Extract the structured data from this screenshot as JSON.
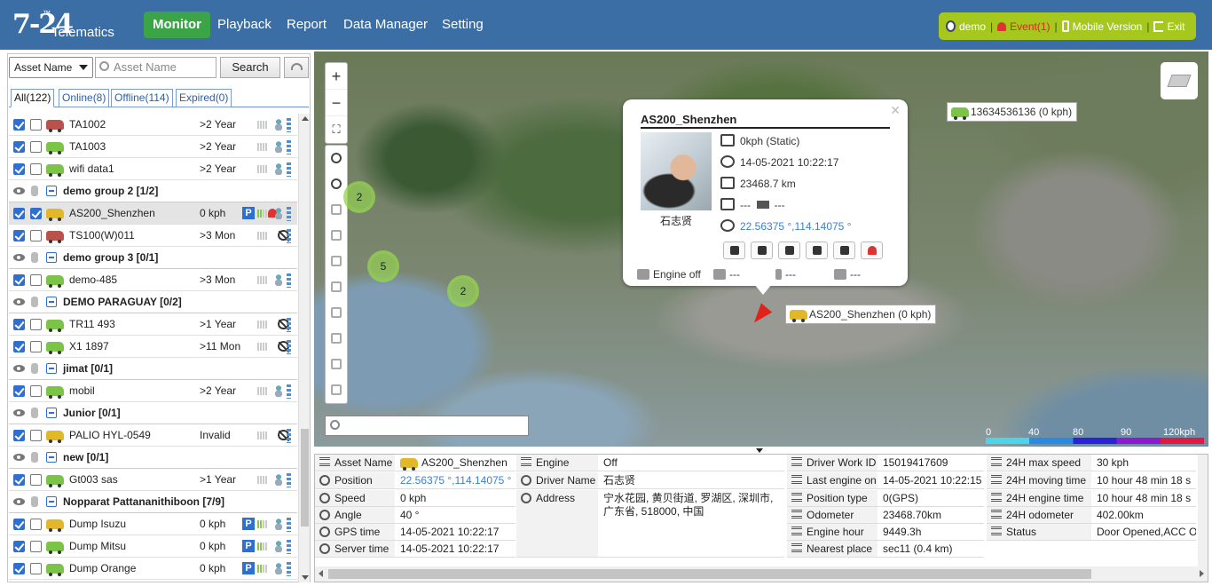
{
  "brand": {
    "logo_mark": "7-24",
    "logo_text": "Telematics",
    "tm": "™"
  },
  "nav": [
    "Monitor",
    "Playback",
    "Report",
    "Data Manager",
    "Setting"
  ],
  "user": {
    "name": "demo",
    "event": "Event(1)",
    "mobile": "Mobile Version",
    "exit": "Exit"
  },
  "filter": {
    "type_value": "Asset Name",
    "search_placeholder": "Asset Name",
    "search_button": "Search"
  },
  "tabs": [
    "All(122)",
    "Online(8)",
    "Offline(114)",
    "Expired(0)"
  ],
  "rows": [
    {
      "kind": "asset",
      "name": "TA1002",
      "time": ">2 Year",
      "car": "r",
      "cb2": false
    },
    {
      "kind": "asset",
      "name": "TA1003",
      "time": ">2 Year",
      "car": "g",
      "cb2": false
    },
    {
      "kind": "asset",
      "name": "wifi data1",
      "time": ">2 Year",
      "car": "g",
      "cb2": false
    },
    {
      "kind": "group",
      "name": "demo group 2 [1/2]"
    },
    {
      "kind": "asset",
      "name": "AS200_Shenzhen",
      "time": "0 kph",
      "car": "y",
      "cb2": true,
      "parked": true,
      "alarm": true,
      "selected": true
    },
    {
      "kind": "asset",
      "name": "TS100(W)011",
      "time": ">3 Mon",
      "car": "r",
      "cb2": false,
      "hidden": true
    },
    {
      "kind": "group",
      "name": "demo group 3 [0/1]"
    },
    {
      "kind": "asset",
      "name": "demo-485",
      "time": ">3 Mon",
      "car": "g",
      "cb2": false
    },
    {
      "kind": "group",
      "name": "DEMO PARAGUAY [0/2]"
    },
    {
      "kind": "asset",
      "name": "TR11 493",
      "time": ">1 Year",
      "car": "g",
      "cb2": false,
      "hidden": true
    },
    {
      "kind": "asset",
      "name": "X1 1897",
      "time": ">11 Mon",
      "car": "g",
      "cb2": false,
      "hidden": true
    },
    {
      "kind": "group",
      "name": "jimat [0/1]"
    },
    {
      "kind": "asset",
      "name": "mobil",
      "time": ">2 Year",
      "car": "g",
      "cb2": false
    },
    {
      "kind": "group",
      "name": "Junior [0/1]"
    },
    {
      "kind": "asset",
      "name": "PALIO HYL-0549",
      "time": "Invalid",
      "car": "y",
      "cb2": false,
      "hidden": true
    },
    {
      "kind": "group",
      "name": "new [0/1]"
    },
    {
      "kind": "asset",
      "name": "Gt003 sas",
      "time": ">1 Year",
      "car": "g",
      "cb2": false
    },
    {
      "kind": "group",
      "name": "Nopparat Pattananithiboon [7/9]"
    },
    {
      "kind": "asset",
      "name": "Dump Isuzu",
      "time": "0 kph",
      "car": "y",
      "cb2": false,
      "parked": true
    },
    {
      "kind": "asset",
      "name": "Dump Mitsu",
      "time": "0 kph",
      "car": "g",
      "cb2": false,
      "parked": true
    },
    {
      "kind": "asset",
      "name": "Dump Orange",
      "time": "0 kph",
      "car": "g",
      "cb2": false,
      "parked": true
    }
  ],
  "map": {
    "clusters": [
      "2",
      "5",
      "2"
    ],
    "label_vehicle": "AS200_Shenzhen (0 kph)",
    "label_other": "13634536136 (0 kph)",
    "scale": [
      "0",
      "40",
      "80",
      "90",
      "120kph"
    ]
  },
  "popup": {
    "title": "AS200_Shenzhen",
    "driver": "石志贤",
    "speed": "0kph (Static)",
    "time": "14-05-2021 10:22:17",
    "odometer": "23468.7 km",
    "gps_a": "---",
    "gps_b": "---",
    "coords": "22.56375 °,114.14075 °",
    "engine": "Engine off",
    "fuel": "---",
    "temp": "---",
    "battery": "---"
  },
  "details": {
    "asset_name": {
      "label": "Asset Name",
      "value": "AS200_Shenzhen"
    },
    "position": {
      "label": "Position",
      "value": "22.56375 °,114.14075 °"
    },
    "speed": {
      "label": "Speed",
      "value": "0 kph"
    },
    "angle": {
      "label": "Angle",
      "value": "40 °"
    },
    "gps_time": {
      "label": "GPS time",
      "value": "14-05-2021 10:22:17"
    },
    "server_time": {
      "label": "Server time",
      "value": "14-05-2021 10:22:17"
    },
    "engine": {
      "label": "Engine",
      "value": "Off"
    },
    "driver_name": {
      "label": "Driver Name",
      "value": "石志贤"
    },
    "address": {
      "label": "Address",
      "value": "宁水花园, 黄贝街道, 罗湖区, 深圳市, 广东省, 518000, 中国"
    },
    "driver_work_id": {
      "label": "Driver Work ID",
      "value": "15019417609"
    },
    "last_engine_on": {
      "label": "Last engine on",
      "value": "14-05-2021 10:22:15"
    },
    "position_type": {
      "label": "Position type",
      "value": "0(GPS)"
    },
    "odometer": {
      "label": "Odometer",
      "value": "23468.70km"
    },
    "engine_hour": {
      "label": "Engine hour",
      "value": "9449.3h"
    },
    "nearest_place": {
      "label": "Nearest place",
      "value": "sec11 (0.4 km)"
    },
    "max_speed": {
      "label": "24H max speed",
      "value": "30 kph"
    },
    "moving_time": {
      "label": "24H moving time",
      "value": "10 hour 48 min 18 s"
    },
    "engine_time": {
      "label": "24H engine time",
      "value": "10 hour 48 min 18 s"
    },
    "odo24": {
      "label": "24H odometer",
      "value": "402.00km"
    },
    "status": {
      "label": "Status",
      "value": "Door Opened,ACC Off"
    }
  }
}
